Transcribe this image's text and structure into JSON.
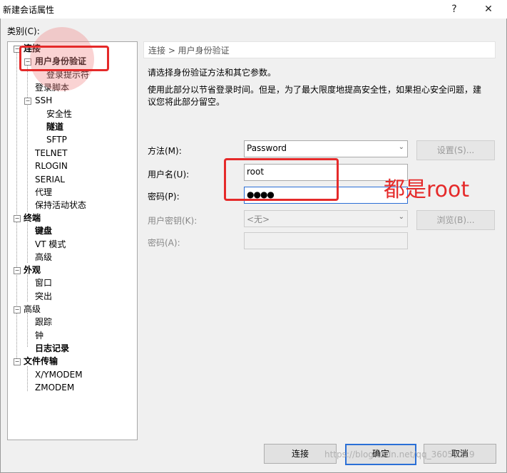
{
  "window": {
    "title": "新建会话属性",
    "help": "?",
    "close": "✕"
  },
  "category_label": "类别(C):",
  "tree": {
    "connection": "连接",
    "auth": "用户身份验证",
    "login_prompts": "登录提示符",
    "login_script": "登录脚本",
    "ssh": "SSH",
    "security": "安全性",
    "tunnel": "隧道",
    "sftp": "SFTP",
    "telnet": "TELNET",
    "rlogin": "RLOGIN",
    "serial": "SERIAL",
    "proxy": "代理",
    "keepalive": "保持活动状态",
    "terminal": "终端",
    "keyboard": "键盘",
    "vt_mode": "VT 模式",
    "advanced1": "高级",
    "appearance": "外观",
    "window": "窗口",
    "highlight": "突出",
    "advanced2": "高级",
    "trace": "跟踪",
    "bell": "钟",
    "logging": "日志记录",
    "file_transfer": "文件传输",
    "xymodem": "X/YMODEM",
    "zmodem": "ZMODEM"
  },
  "panel": {
    "breadcrumb": "连接 > 用户身份验证",
    "desc1": "请选择身份验证方法和其它参数。",
    "desc2a": "使用此部分以节省登录时间。但是，为了最大限度地提高安全性，如果担心安全问题，建",
    "desc2b": "议您将此部分留空。",
    "method_label": "方法(M):",
    "method_value": "Password",
    "settings_button": "设置(S)...",
    "username_label": "用户名(U):",
    "username_value": "root",
    "password_label": "密码(P):",
    "password_value": "●●●●",
    "userkey_label": "用户密钥(K):",
    "userkey_value": "<无>",
    "browse_button": "浏览(B)...",
    "passphrase_label": "密码(A):"
  },
  "annotation": "都是root",
  "footer": {
    "connect": "连接",
    "ok": "确定",
    "cancel": "取消"
  },
  "watermark": "https://blog.csdn.net/qq_36056219"
}
